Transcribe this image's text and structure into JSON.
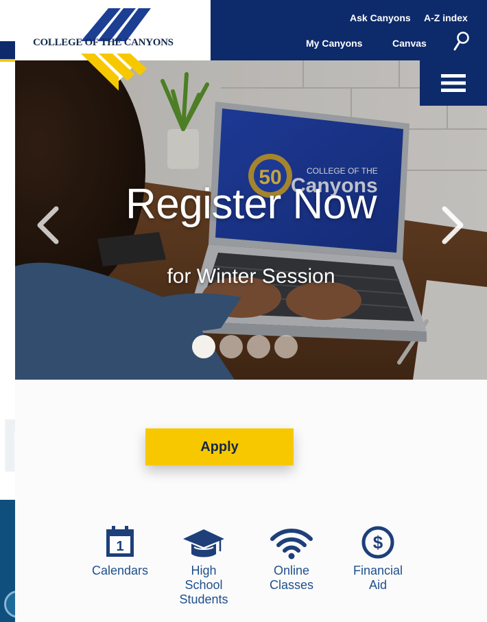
{
  "header": {
    "logo_text": "COLLEGE OF THE CANYONS",
    "links": {
      "ask_canyons": "Ask Canyons",
      "a_z_index": "A-Z index",
      "my_canyons": "My Canyons",
      "canvas": "Canvas"
    },
    "icons": {
      "search": "search-icon",
      "menu": "hamburger-menu-icon"
    }
  },
  "hero": {
    "title": "Register Now",
    "subtitle": "for Winter Session",
    "screen_logo_top": "COLLEGE OF THE",
    "screen_logo_main": "Canyons",
    "screen_badge": "50",
    "slide_count": 4,
    "active_slide": 1,
    "icons": {
      "prev": "chevron-left-icon",
      "next": "chevron-right-icon"
    }
  },
  "cta": {
    "apply_label": "Apply"
  },
  "quick_links": [
    {
      "line1": "Calendars",
      "line2": "",
      "line3": "",
      "icon": "calendar-icon"
    },
    {
      "line1": "High",
      "line2": "School",
      "line3": "Students",
      "icon": "graduation-cap-icon"
    },
    {
      "line1": "Online",
      "line2": "Classes",
      "line3": "",
      "icon": "wifi-icon"
    },
    {
      "line1": "Financial",
      "line2": "Aid",
      "line3": "",
      "icon": "dollar-circle-icon"
    }
  ],
  "colors": {
    "navy": "#0d2a6b",
    "gold": "#f7c800",
    "link_blue": "#1e4f8c",
    "teal_panel": "#0e4f7e"
  }
}
